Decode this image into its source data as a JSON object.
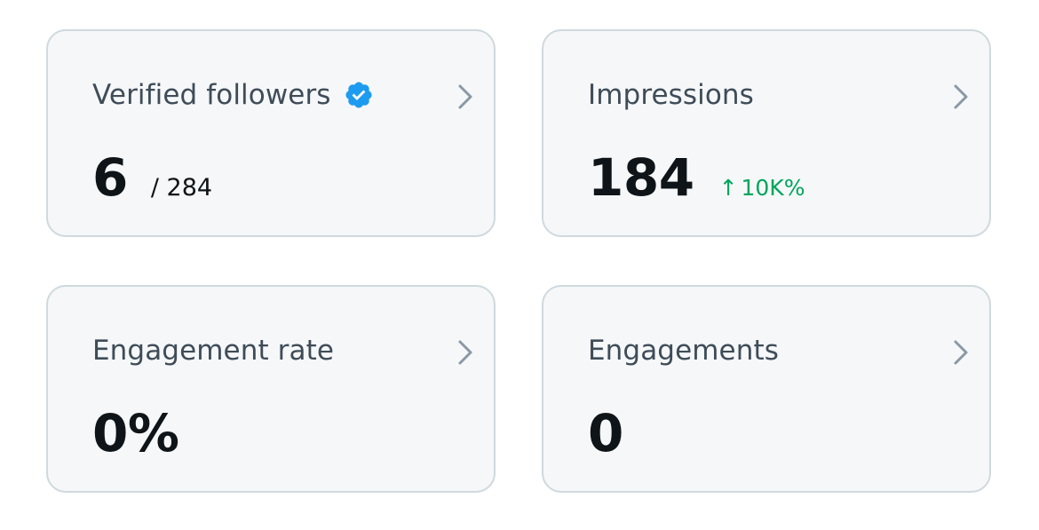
{
  "cards": [
    {
      "title": "Verified followers",
      "verified_icon": "verified-badge-icon",
      "value": "6",
      "total": "/ 284",
      "chevron_icon": "chevron-right-icon"
    },
    {
      "title": "Impressions",
      "value": "184",
      "change_arrow": "↑",
      "change": "10K%",
      "chevron_icon": "chevron-right-icon"
    },
    {
      "title": "Engagement rate",
      "value": "0%",
      "chevron_icon": "chevron-right-icon"
    },
    {
      "title": "Engagements",
      "value": "0",
      "chevron_icon": "chevron-right-icon"
    }
  ],
  "colors": {
    "card_background": "#f5f7f8",
    "card_border": "#cfd9de",
    "title_text": "#3f4c58",
    "value_text": "#0f1419",
    "positive_change": "#00a55c",
    "verified_badge": "#1d9bf0",
    "chevron": "#8b98a5"
  }
}
